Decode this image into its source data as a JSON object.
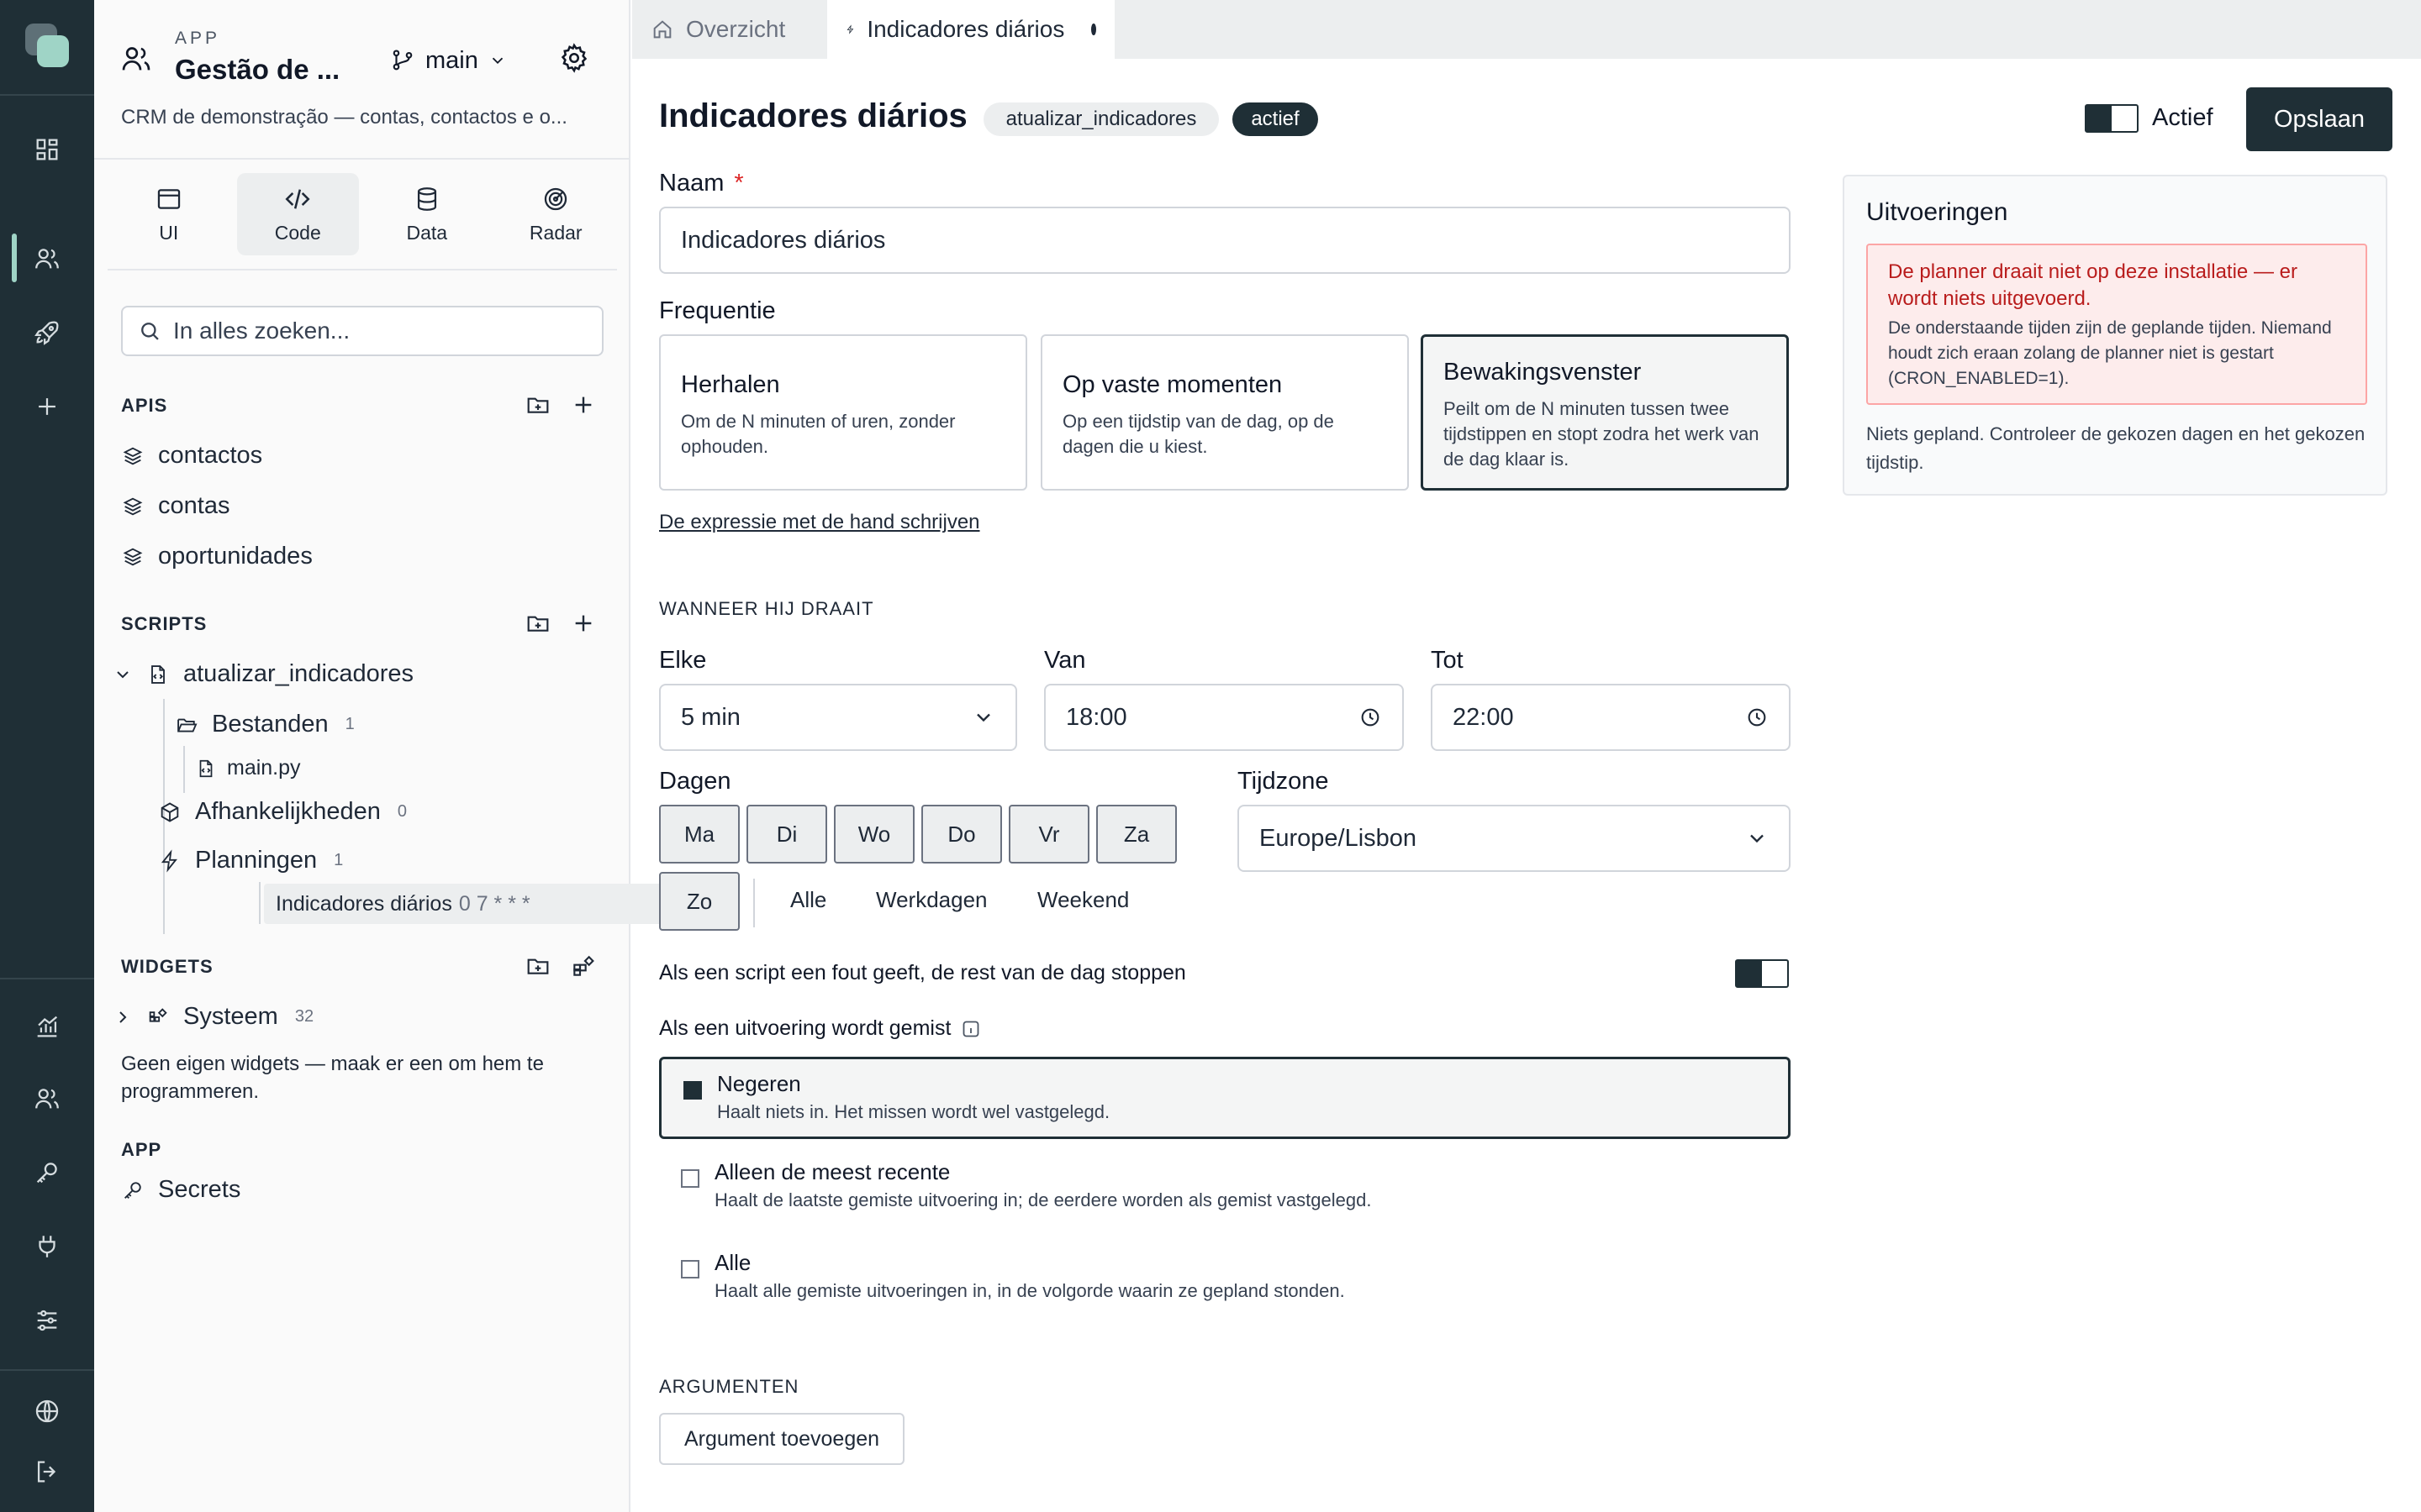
{
  "app": {
    "label": "APP",
    "title": "Gestão de ...",
    "branch": "main",
    "description": "CRM de demonstração — contas, contactos e o..."
  },
  "mode_tabs": [
    {
      "label": "UI",
      "icon": "window-icon"
    },
    {
      "label": "Code",
      "icon": "code-icon",
      "active": true
    },
    {
      "label": "Data",
      "icon": "database-icon"
    },
    {
      "label": "Radar",
      "icon": "radar-icon"
    }
  ],
  "search": {
    "placeholder": "In alles zoeken..."
  },
  "apis": {
    "heading": "APIS",
    "items": [
      "contactos",
      "contas",
      "oportunidades"
    ]
  },
  "scripts": {
    "heading": "SCRIPTS",
    "script_name": "atualizar_indicadores",
    "files_label": "Bestanden",
    "files_count": "1",
    "file_name": "main.py",
    "deps_label": "Afhankelijkheden",
    "deps_count": "0",
    "plans_label": "Planningen",
    "plans_count": "1",
    "schedule_name": "Indicadores diários",
    "schedule_cron": "0 7 * * *"
  },
  "widgets": {
    "heading": "WIDGETS",
    "system_label": "Systeem",
    "system_count": "32",
    "note": "Geen eigen widgets — maak er een om hem te programmeren."
  },
  "app_section": {
    "heading": "APP",
    "secrets_label": "Secrets"
  },
  "tabs": [
    {
      "label": "Overzicht"
    },
    {
      "label": "Indicadores diários",
      "unsaved": true
    }
  ],
  "header": {
    "title": "Indicadores diários",
    "script_chip": "atualizar_indicadores",
    "status_chip": "actief",
    "active_label": "Actief",
    "save_label": "Opslaan"
  },
  "form": {
    "name_label": "Naam",
    "required_mark": "*",
    "name_value": "Indicadores diários",
    "frequency_label": "Frequentie",
    "frequency_options": [
      {
        "title": "Herhalen",
        "desc": "Om de N minuten of uren, zonder ophouden."
      },
      {
        "title": "Op vaste momenten",
        "desc": "Op een tijdstip van de dag, op de dagen die u kiest."
      },
      {
        "title": "Bewakingsvenster",
        "desc": "Peilt om de N minuten tussen twee tijdstippen en stopt zodra het werk van de dag klaar is.",
        "selected": true
      }
    ],
    "expression_link": "De expressie met de hand schrijven",
    "when_heading": "WANNEER HIJ DRAAIT",
    "every_label": "Elke",
    "every_value": "5 min",
    "from_label": "Van",
    "from_value": "18:00",
    "to_label": "Tot",
    "to_value": "22:00",
    "days_label": "Dagen",
    "days": [
      "Ma",
      "Di",
      "Wo",
      "Do",
      "Vr",
      "Za",
      "Zo"
    ],
    "day_shortcuts": [
      "Alle",
      "Werkdagen",
      "Weekend"
    ],
    "timezone_label": "Tijdzone",
    "timezone_value": "Europe/Lisbon",
    "stop_on_error_label": "Als een script een fout geeft, de rest van de dag stoppen",
    "missed_label": "Als een uitvoering wordt gemist",
    "missed_options": [
      {
        "title": "Negeren",
        "desc": "Haalt niets in. Het missen wordt wel vastgelegd.",
        "selected": true
      },
      {
        "title": "Alleen de meest recente",
        "desc": "Haalt de laatste gemiste uitvoering in; de eerdere worden als gemist vastgelegd."
      },
      {
        "title": "Alle",
        "desc": "Haalt alle gemiste uitvoeringen in, in de volgorde waarin ze gepland stonden."
      }
    ],
    "arguments_heading": "ARGUMENTEN",
    "add_argument_label": "Argument toevoegen"
  },
  "runs": {
    "title": "Uitvoeringen",
    "alert_heading": "De planner draait niet op deze installatie — er wordt niets uitgevoerd.",
    "alert_body": "De onderstaande tijden zijn de geplande tijden. Niemand houdt zich eraan zolang de planner niet is gestart (CRON_ENABLED=1).",
    "empty": "Niets gepland. Controleer de gekozen dagen en het gekozen tijdstip."
  },
  "colors": {
    "rail": "#1f2f36",
    "accent": "#9fd4c6",
    "danger": "#b91c1c"
  }
}
